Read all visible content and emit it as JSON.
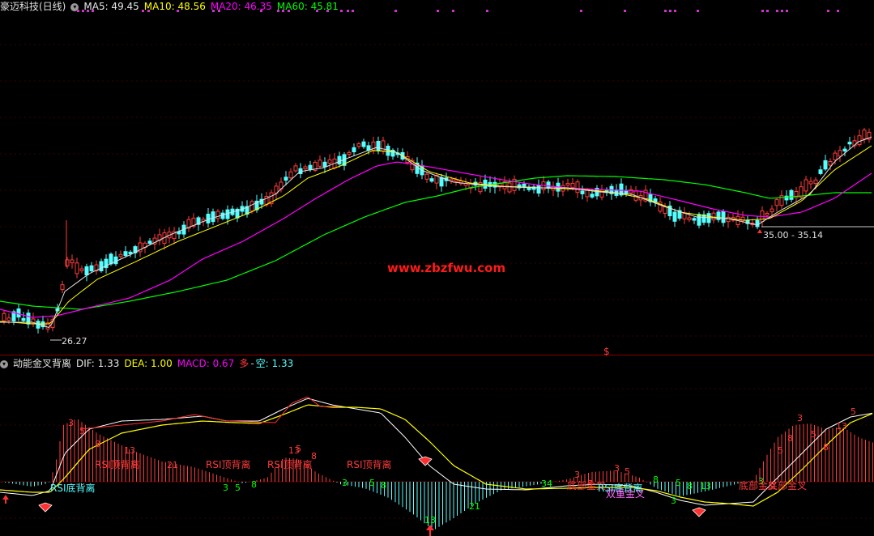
{
  "main_header": {
    "title": "豪迈科技(日线)",
    "ma5_label": "MA5: 49.45",
    "ma10_label": "MA10: 48.56",
    "ma20_label": "MA20: 46.35",
    "ma60_label": "MA60: 45.81"
  },
  "sub_header": {
    "title": "动能金叉背离",
    "dif_label": "DIF: 1.33",
    "dea_label": "DEA: 1.00",
    "macd_label": "MACD: 0.67",
    "duo_label": "多",
    "dash_label": "-",
    "kong_label": "空: 1.33"
  },
  "annotations": {
    "low_price": "26.27",
    "range_label": "35.00 - 35.14",
    "watermark": "www.zbzfwu.com",
    "dollar_mark": "$"
  },
  "signals": [
    "RSI底背离",
    "RSI顶背离",
    "RSI顶背离",
    "RSI顶背离",
    "RSI顶背离",
    "底部金叉",
    "RSI底背离",
    "双重金叉",
    "底部金叉",
    "底部金叉"
  ],
  "numbers": [
    "3",
    "5",
    "8",
    "13",
    "21",
    "3",
    "5",
    "8",
    "13",
    "5",
    "8",
    "3",
    "5",
    "8",
    "13",
    "21",
    "34",
    "3",
    "5",
    "3",
    "5",
    "8",
    "3",
    "5",
    "8",
    "13",
    "5",
    "8",
    "3",
    "5",
    "8",
    "13",
    "3",
    "5"
  ],
  "colors": {
    "background": "#000000",
    "up_candle": "#ff3b3b",
    "down_candle": "#54ffff",
    "ma5": "#e0e0e0",
    "ma10": "#ffff00",
    "ma20": "#ff00ff",
    "ma60": "#00ff00",
    "macd_pos": "#ff3b3b",
    "macd_neg": "#54ffff",
    "watermark": "#ff1a1a"
  }
}
